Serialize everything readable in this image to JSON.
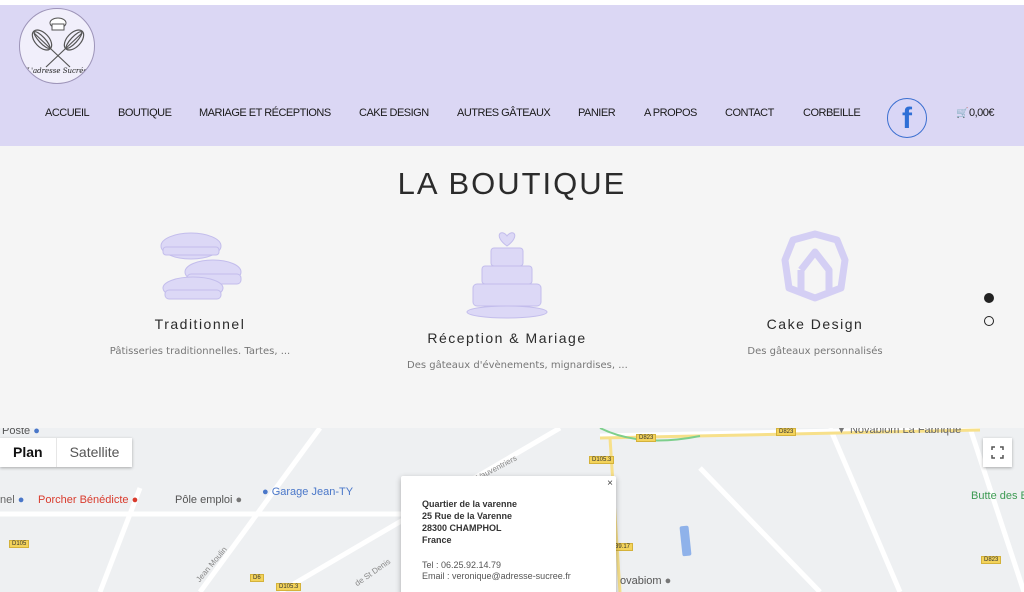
{
  "logo": {
    "text": "L'adresse Sucrée"
  },
  "nav": {
    "items": [
      "ACCUEIL",
      "BOUTIQUE",
      "MARIAGE ET RÉCEPTIONS",
      "CAKE DESIGN",
      "AUTRES GÂTEAUX",
      "PANIER",
      "A PROPOS",
      "CONTACT",
      "CORBEILLE"
    ],
    "facebook_letter": "f",
    "cart_total": "0,00€"
  },
  "boutique": {
    "title": "LA BOUTIQUE",
    "cards": [
      {
        "title": "Traditionnel",
        "desc": "Pâtisseries traditionnelles. Tartes, ...",
        "icon": "pastries-icon"
      },
      {
        "title": "Réception & Mariage",
        "desc": "Des gâteaux d'évènements, mignardises, ...",
        "icon": "wedding-cake-icon"
      },
      {
        "title": "Cake Design",
        "desc": "Des gâteaux personnalisés",
        "icon": "cake-design-icon"
      }
    ],
    "pagination": {
      "count": 2,
      "active_index": 0
    }
  },
  "map": {
    "type_buttons": {
      "plan": "Plan",
      "satellite": "Satellite"
    },
    "pois": {
      "poste": "Poste",
      "porcher": "Porcher Bénédicte",
      "pole_emploi": "Pôle emploi",
      "garage": "Garage Jean-TY",
      "novabiom_fabrique": "Novabiom La Fabrique",
      "butte": "Butte des B",
      "novabiom": "ovabiom",
      "nel": "nel"
    },
    "streets": {
      "vauventriers": "de Vauventriers",
      "jean_moulin": "Jean Moulin",
      "st_denis": "de St Denis"
    },
    "road_tags": [
      "D105",
      "D6",
      "D105.3",
      "D823",
      "D823",
      "D105.3",
      "D823",
      "39.17"
    ],
    "info": {
      "name": "Quartier de la varenne",
      "street": "25 Rue de la Varenne",
      "city": "28300 CHAMPHOL",
      "country": "France",
      "tel": "Tel : 06.25.92.14.79",
      "email": "Email : veronique@adresse-sucree.fr",
      "close": "×"
    },
    "colors": {
      "poi_red": "#d93b2d",
      "poi_blue": "#4a77c9",
      "road_yellow": "#f3d35b"
    }
  }
}
